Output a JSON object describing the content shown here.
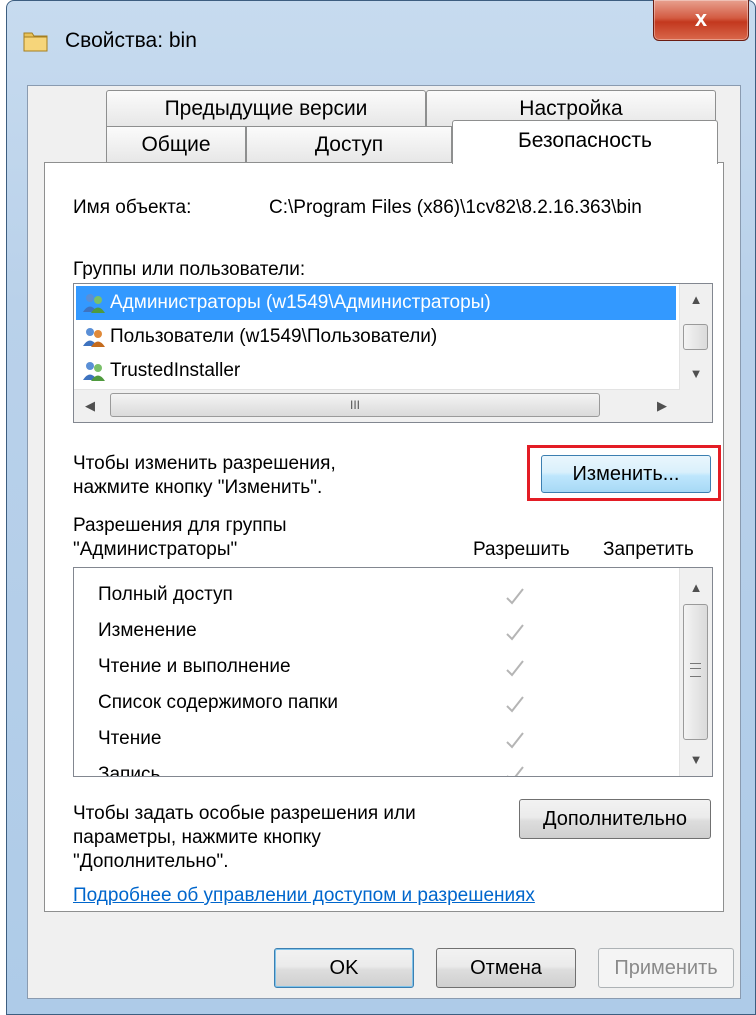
{
  "window": {
    "title": "Свойства: bin",
    "close_label": "x"
  },
  "tabs": {
    "row_back": [
      "Предыдущие версии",
      "Настройка"
    ],
    "row_front": [
      "Общие",
      "Доступ",
      "Безопасность"
    ],
    "active": "Безопасность"
  },
  "security": {
    "object_name_label": "Имя объекта:",
    "object_name_value": "C:\\Program Files (x86)\\1cv82\\8.2.16.363\\bin",
    "groups_label": "Группы или пользователи:",
    "groups": [
      {
        "name": "Администраторы (w1549\\Администраторы)",
        "selected": true,
        "icon": "users-icon"
      },
      {
        "name": "Пользователи (w1549\\Пользователи)",
        "selected": false,
        "icon": "users-icon"
      },
      {
        "name": "TrustedInstaller",
        "selected": false,
        "icon": "users-icon"
      }
    ],
    "hscroll_grip": "III",
    "change_hint_line1": "Чтобы изменить разрешения,",
    "change_hint_line2": "нажмите кнопку \"Изменить\".",
    "change_button": "Изменить...",
    "permissions_label_line1": "Разрешения для группы",
    "permissions_label_line2": "\"Администраторы\"",
    "allow_header": "Разрешить",
    "deny_header": "Запретить",
    "permissions": [
      {
        "name": "Полный доступ",
        "allow": true,
        "deny": false
      },
      {
        "name": "Изменение",
        "allow": true,
        "deny": false
      },
      {
        "name": "Чтение и выполнение",
        "allow": true,
        "deny": false
      },
      {
        "name": "Список содержимого папки",
        "allow": true,
        "deny": false
      },
      {
        "name": "Чтение",
        "allow": true,
        "deny": false
      },
      {
        "name": "Запись",
        "allow": true,
        "deny": false
      }
    ],
    "advanced_hint_line1": "Чтобы задать особые разрешения или",
    "advanced_hint_line2": "параметры, нажмите кнопку",
    "advanced_hint_line3": "\"Дополнительно\".",
    "advanced_button": "Дополнительно",
    "help_link": "Подробнее об управлении доступом и разрешениях"
  },
  "buttons": {
    "ok": "OK",
    "cancel": "Отмена",
    "apply": "Применить"
  },
  "colors": {
    "highlight": "#3399ff",
    "callout": "#e31d25",
    "link": "#0066cc"
  }
}
